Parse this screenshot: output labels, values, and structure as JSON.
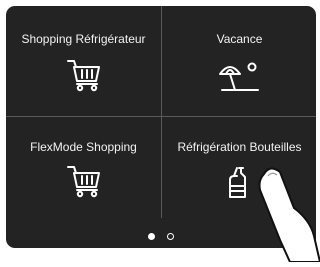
{
  "tiles": [
    {
      "label": "Shopping Réfrigérateur",
      "icon": "shopping-cart-icon"
    },
    {
      "label": "Vacance",
      "icon": "beach-umbrella-sun-icon"
    },
    {
      "label": "FlexMode Shopping",
      "icon": "shopping-cart-icon"
    },
    {
      "label": "Réfrigération Bouteilles",
      "icon": "bottle-glass-icon"
    }
  ],
  "pager": {
    "total_pages": 2,
    "current_page": 1
  },
  "colors": {
    "background": "#232323",
    "text": "#f2f2f2",
    "divider": "#5a5a5a",
    "icon": "#ffffff"
  }
}
